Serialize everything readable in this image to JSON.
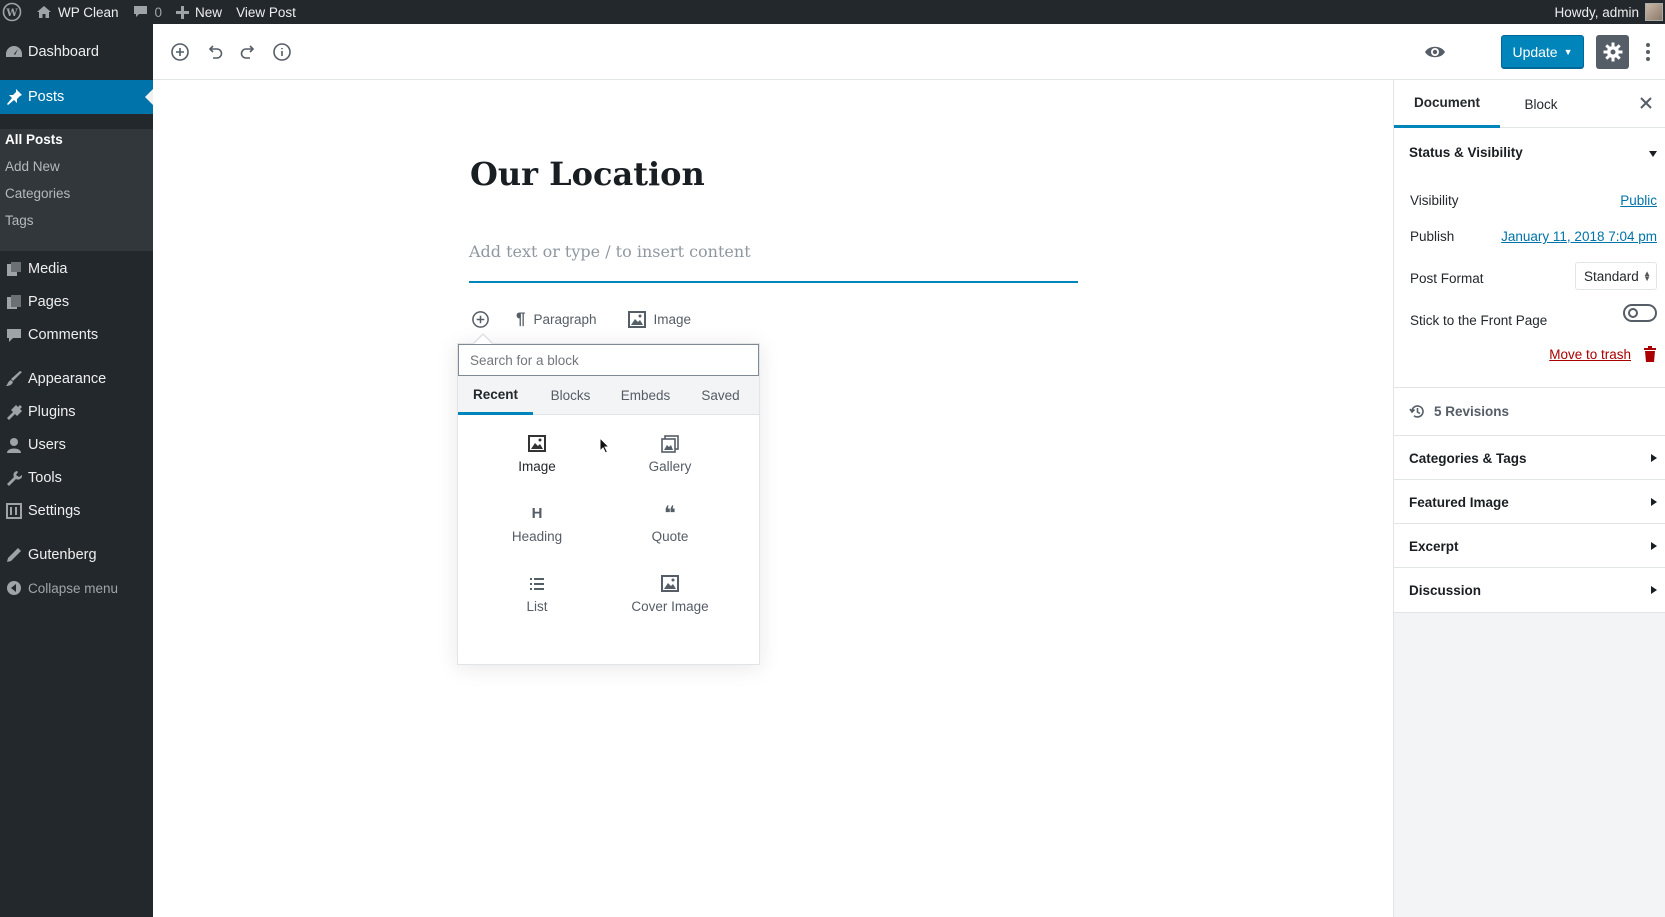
{
  "adminbar": {
    "site_name": "WP Clean",
    "comments_count": "0",
    "new_label": "New",
    "view_post_label": "View Post",
    "howdy": "Howdy, admin"
  },
  "menu": {
    "dashboard": "Dashboard",
    "posts": "Posts",
    "posts_sub": [
      "All Posts",
      "Add New",
      "Categories",
      "Tags"
    ],
    "media": "Media",
    "pages": "Pages",
    "comments": "Comments",
    "appearance": "Appearance",
    "plugins": "Plugins",
    "users": "Users",
    "tools": "Tools",
    "settings": "Settings",
    "gutenberg": "Gutenberg",
    "collapse": "Collapse menu"
  },
  "toolbar": {
    "update_label": "Update"
  },
  "editor": {
    "title": "Our Location",
    "paragraph_placeholder": "Add text or type / to insert content",
    "quick_inserts": [
      "Paragraph",
      "Image"
    ]
  },
  "inserter": {
    "search_placeholder": "Search for a block",
    "tabs": [
      "Recent",
      "Blocks",
      "Embeds",
      "Saved"
    ],
    "active_tab": "Recent",
    "blocks": [
      {
        "label": "Image",
        "icon": "image-icon"
      },
      {
        "label": "Gallery",
        "icon": "gallery-icon"
      },
      {
        "label": "Heading",
        "icon": "heading-icon",
        "glyph": "H"
      },
      {
        "label": "Quote",
        "icon": "quote-icon",
        "glyph": "❝"
      },
      {
        "label": "List",
        "icon": "list-icon"
      },
      {
        "label": "Cover Image",
        "icon": "cover-image-icon"
      }
    ]
  },
  "sidebar": {
    "tabs": [
      "Document",
      "Block"
    ],
    "status_panel": {
      "title": "Status & Visibility",
      "visibility_label": "Visibility",
      "visibility_value": "Public",
      "publish_label": "Publish",
      "publish_value": "January 11, 2018 7:04 pm",
      "format_label": "Post Format",
      "format_value": "Standard",
      "sticky_label": "Stick to the Front Page",
      "sticky_on": false,
      "trash_label": "Move to trash"
    },
    "revisions": "5 Revisions",
    "panels": [
      "Categories & Tags",
      "Featured Image",
      "Excerpt",
      "Discussion"
    ]
  },
  "colors": {
    "accent": "#0085ba",
    "admin_dark": "#23282d",
    "active_menu": "#0073aa",
    "danger": "#aa0000"
  }
}
